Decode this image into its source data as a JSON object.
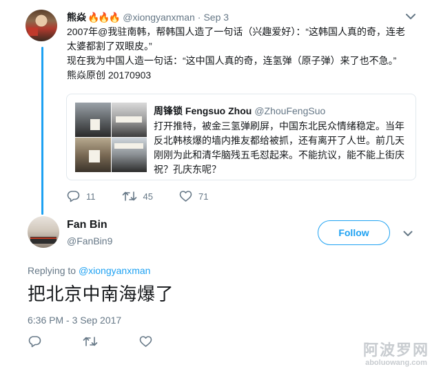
{
  "top_tweet": {
    "author_name": "熊焱",
    "flames": "🔥🔥🔥",
    "handle": "@xiongyanxman",
    "separator": "·",
    "date": "Sep 3",
    "lines": [
      "2007年@我驻南韩，帮韩国人造了一句话（兴趣爱好）：“这韩国人真的奇，连老",
      "太婆都割了双眼皮。”",
      "现在我为中国人造一句话：“这中国人真的奇，连氢弹（原子弹）来了也不急。”",
      "熊焱原创 20170903"
    ],
    "quote": {
      "author_name": "周锋锁 Fengsuo Zhou",
      "handle": "@ZhouFengSuo",
      "lines": [
        "打开推特，被金三氢弹刷屏，中国东北民众情绪稳定。当年",
        "反北韩核爆的墙内推友都给被抓，还有离开了人世。前几天",
        "刚刚为此和清华脑残五毛怼起来。不能抗议，能不能上街庆",
        "祝？孔庆东呢？"
      ]
    },
    "actions": {
      "reply_count": "11",
      "retweet_count": "45",
      "like_count": "71"
    }
  },
  "main_tweet": {
    "author_name": "Fan Bin",
    "handle": "@FanBin9",
    "follow_label": "Follow",
    "replying_prefix": "Replying to",
    "replying_handle": "@xiongyanxman",
    "text": "把北京中南海爆了",
    "timestamp": "6:36 PM - 3 Sep 2017"
  },
  "watermark": {
    "cn": "阿波罗网",
    "url": "aboluowang.com"
  },
  "colors": {
    "accent": "#1da1f2",
    "secondary_text": "#657786",
    "border": "#e1e8ed"
  },
  "icons": [
    "chevron-down-icon",
    "reply-icon",
    "retweet-icon",
    "like-icon"
  ]
}
